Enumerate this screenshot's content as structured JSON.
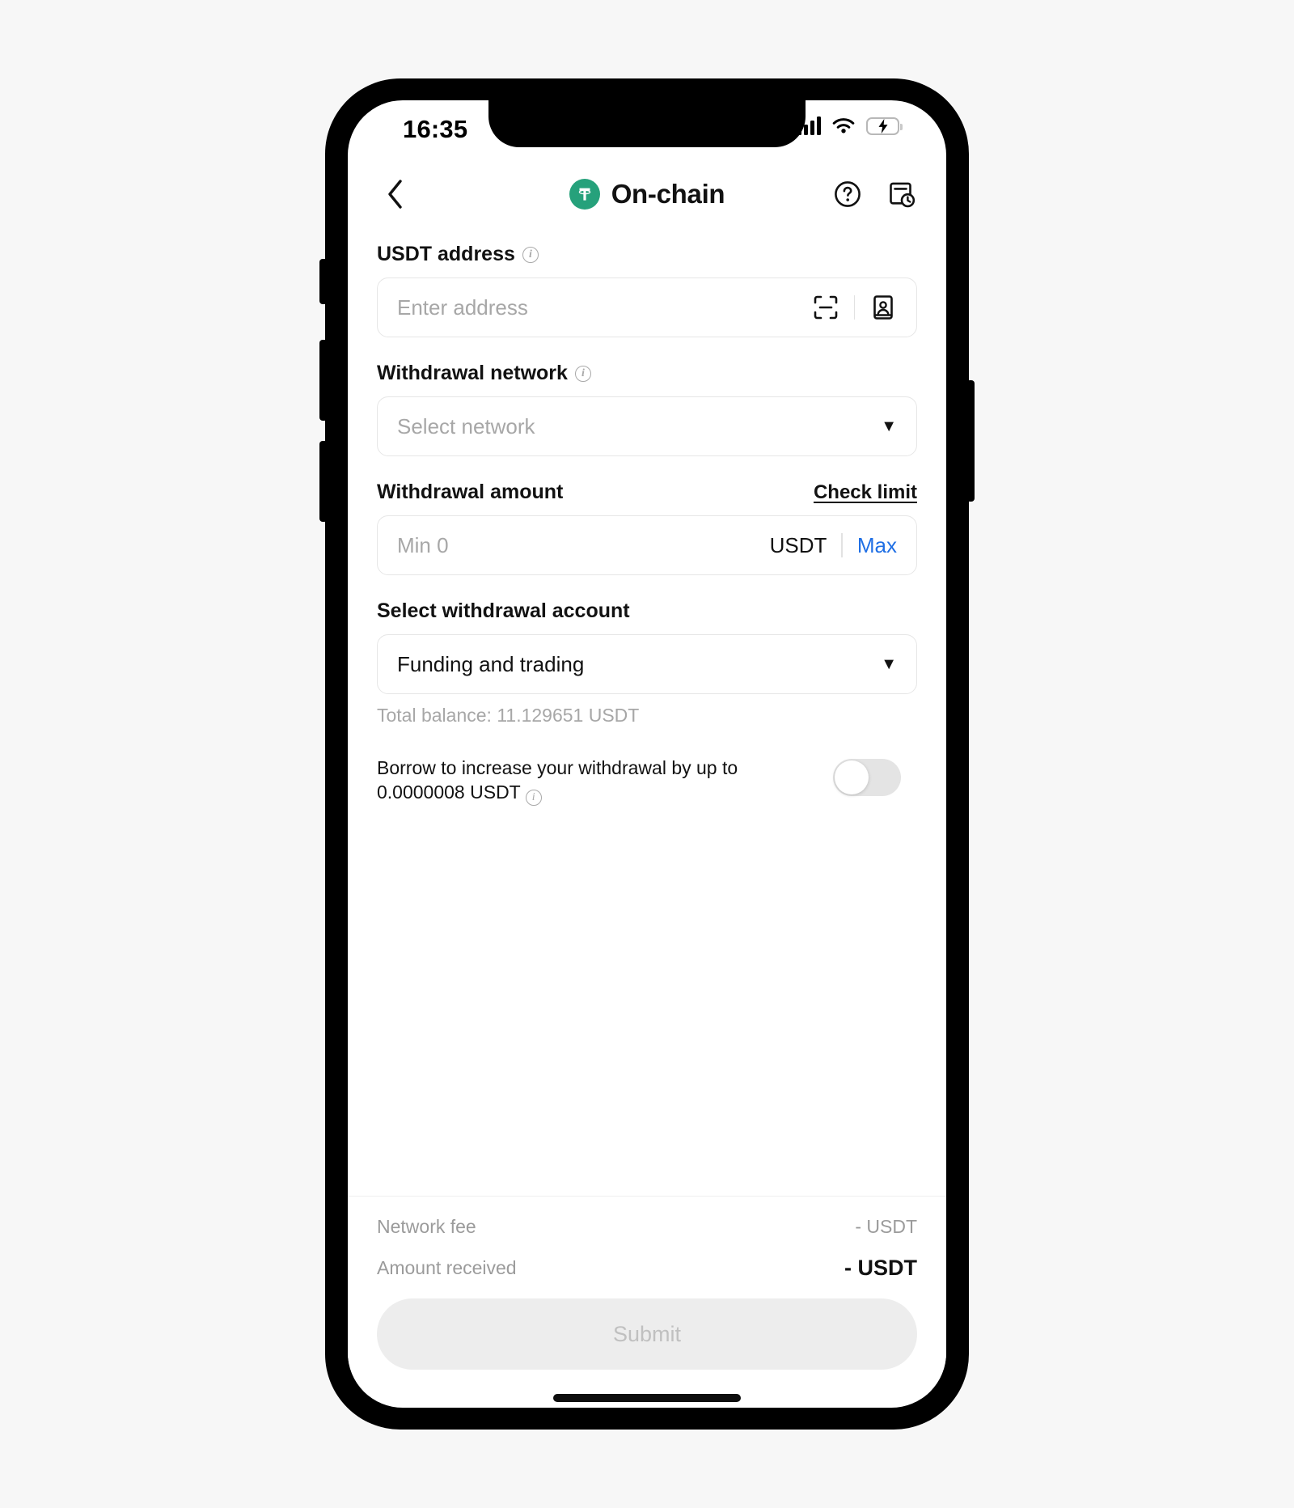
{
  "status_bar": {
    "time": "16:35",
    "signal_icon": "cellular-signal-icon",
    "wifi_icon": "wifi-icon",
    "battery_icon": "battery-charging-icon",
    "battery_color": "#32d74b"
  },
  "header": {
    "back_icon": "chevron-left-icon",
    "logo_icon": "tether-logo-icon",
    "logo_color": "#26A17B",
    "title": "On-chain",
    "help_icon": "question-circle-icon",
    "history_icon": "order-history-icon"
  },
  "form": {
    "address": {
      "label": "USDT address",
      "info_icon": "info-icon",
      "placeholder": "Enter address",
      "value": "",
      "scan_icon": "scan-qr-icon",
      "contacts_icon": "address-book-icon"
    },
    "network": {
      "label": "Withdrawal network",
      "info_icon": "info-icon",
      "placeholder": "Select network",
      "value": "",
      "chevron_icon": "chevron-down-icon"
    },
    "amount": {
      "label": "Withdrawal amount",
      "check_limit_label": "Check limit",
      "placeholder": "Min 0",
      "value": "",
      "unit": "USDT",
      "max_label": "Max",
      "max_color": "#1f6fe5"
    },
    "account": {
      "label": "Select withdrawal account",
      "value": "Funding and trading",
      "chevron_icon": "chevron-down-icon",
      "balance_text": "Total balance: 11.129651 USDT"
    },
    "borrow": {
      "text": "Borrow to increase your withdrawal by up to 0.0000008 USDT",
      "info_icon": "info-icon",
      "toggle_state": "off"
    }
  },
  "summary": {
    "network_fee_label": "Network fee",
    "network_fee_value": "- USDT",
    "amount_received_label": "Amount received",
    "amount_received_value": "- USDT"
  },
  "submit": {
    "label": "Submit",
    "state": "disabled"
  }
}
